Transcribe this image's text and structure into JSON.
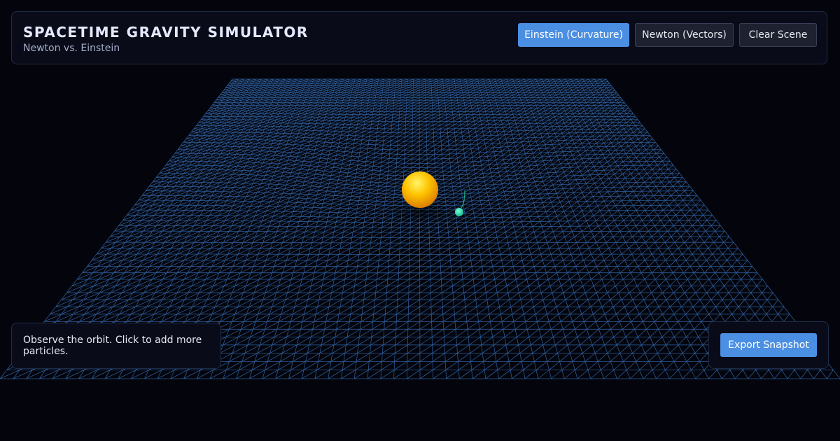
{
  "header": {
    "title": "SPACETIME GRAVITY SIMULATOR",
    "subtitle": "Newton vs. Einstein"
  },
  "toolbar": {
    "einstein_label": "Einstein (Curvature)",
    "newton_label": "Newton (Vectors)",
    "clear_label": "Clear Scene",
    "active_mode": "einstein"
  },
  "info": {
    "message": "Observe the orbit. Click to add more particles."
  },
  "export": {
    "label": "Export Snapshot"
  },
  "colors": {
    "background": "#04050c",
    "grid": "#3a78c8",
    "accent": "#4b8fe3",
    "star": "#ffb400",
    "particle": "#22e3b4"
  },
  "scene": {
    "objects": [
      {
        "name": "star",
        "icon": "sun-sphere"
      },
      {
        "name": "particle",
        "icon": "orbiting-particle"
      }
    ]
  }
}
